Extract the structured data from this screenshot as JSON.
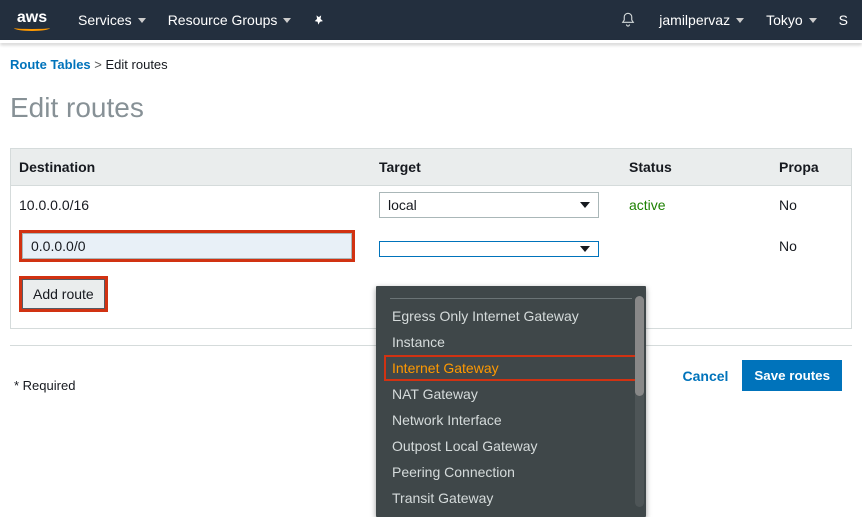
{
  "nav": {
    "services": "Services",
    "resourceGroups": "Resource Groups",
    "user": "jamilpervaz",
    "region": "Tokyo",
    "support": "S"
  },
  "breadcrumb": {
    "routeTables": "Route Tables",
    "current": "Edit routes"
  },
  "page": {
    "title": "Edit routes"
  },
  "table": {
    "headers": {
      "destination": "Destination",
      "target": "Target",
      "status": "Status",
      "propagated": "Propa"
    },
    "rows": [
      {
        "destination": "10.0.0.0/16",
        "target": "local",
        "status": "active",
        "propagated": "No"
      },
      {
        "destination": "0.0.0.0/0",
        "target": "",
        "status": "",
        "propagated": "No"
      }
    ]
  },
  "buttons": {
    "addRoute": "Add route",
    "cancel": "Cancel",
    "save": "Save routes"
  },
  "labels": {
    "required": "* Required"
  },
  "dropdown": {
    "options": [
      "Egress Only Internet Gateway",
      "Instance",
      "Internet Gateway",
      "NAT Gateway",
      "Network Interface",
      "Outpost Local Gateway",
      "Peering Connection",
      "Transit Gateway"
    ],
    "selectedIndex": 2
  }
}
